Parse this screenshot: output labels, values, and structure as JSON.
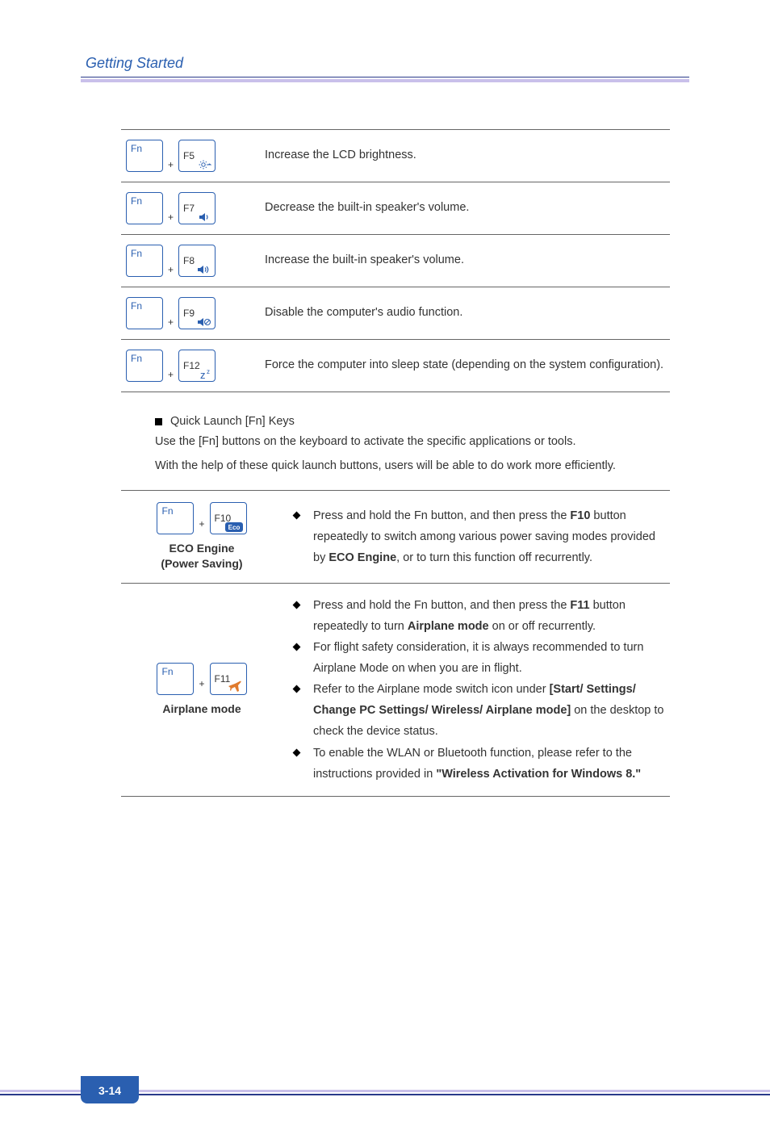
{
  "header": {
    "title": "Getting Started"
  },
  "fn_rows": [
    {
      "key1": "Fn",
      "key2": "F5",
      "icon": "brightness-up",
      "desc": "Increase the LCD brightness."
    },
    {
      "key1": "Fn",
      "key2": "F7",
      "icon": "volume-down",
      "desc": "Decrease the built-in speaker's volume."
    },
    {
      "key1": "Fn",
      "key2": "F8",
      "icon": "volume-up",
      "desc": "Increase the built-in speaker's volume."
    },
    {
      "key1": "Fn",
      "key2": "F9",
      "icon": "mute",
      "desc": "Disable the computer's audio function."
    },
    {
      "key1": "Fn",
      "key2": "F12",
      "icon": "sleep",
      "desc": "Force the computer into sleep state (depending on the system configuration)."
    }
  ],
  "quick_launch": {
    "heading": "Quick Launch [Fn] Keys",
    "intro1": "Use the [Fn] buttons on the keyboard to activate the specific applications or tools.",
    "intro2": "With the help of these quick launch buttons, users will be able to do work more efficiently."
  },
  "ql_rows": [
    {
      "key1": "Fn",
      "key2": "F10",
      "icon": "eco",
      "caption_line1": "ECO Engine",
      "caption_line2": "(Power Saving)",
      "bullets": [
        {
          "pre": "Press and hold the Fn button, and then press the ",
          "b1": "F10",
          "mid1": " button repeatedly to switch among various power saving modes provided by ",
          "b2": "ECO Engine",
          "post": ", or to turn this function off recurrently."
        }
      ]
    },
    {
      "key1": "Fn",
      "key2": "F11",
      "icon": "airplane",
      "caption_line1": "Airplane mode",
      "caption_line2": "",
      "bullets": [
        {
          "pre": "Press and hold the Fn button, and then press the ",
          "b1": "F11",
          "mid1": " button repeatedly to turn ",
          "b2": "Airplane mode",
          "post": " on or off recurrently."
        },
        {
          "pre": "For flight safety consideration, it is always recommended to turn Airplane Mode on when you are in flight.",
          "b1": "",
          "mid1": "",
          "b2": "",
          "post": ""
        },
        {
          "pre": "Refer to the Airplane mode switch icon under ",
          "b1": "[Start/ Settings/ Change PC Settings/ Wireless/ Airplane mode]",
          "mid1": " on the desktop to check the device status.",
          "b2": "",
          "post": ""
        },
        {
          "pre": "To enable the WLAN or Bluetooth function, please refer to the instructions provided in ",
          "b1": "\"Wireless Activation for Windows 8.\"",
          "mid1": "",
          "b2": "",
          "post": ""
        }
      ]
    }
  ],
  "page_number": "3-14"
}
